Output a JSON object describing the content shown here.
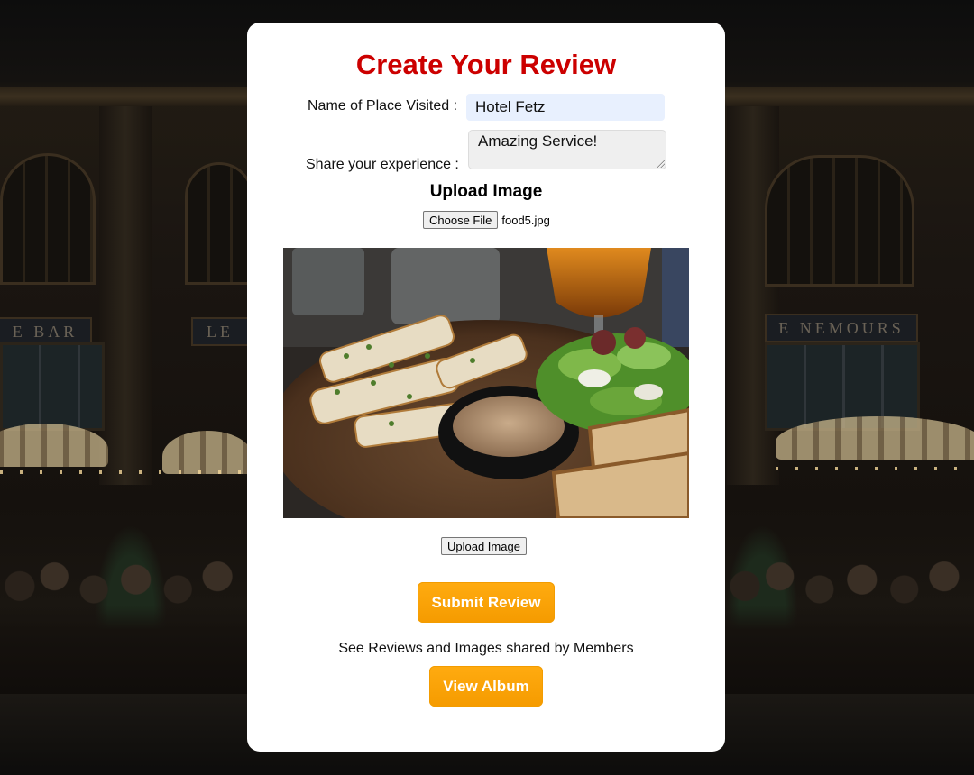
{
  "form": {
    "title": "Create Your Review",
    "name_label": "Name of Place Visited :",
    "name_value": "Hotel Fetz",
    "experience_label": "Share your experience :",
    "experience_value": "Amazing Service!",
    "upload_heading": "Upload Image",
    "choose_file_label": "Choose File",
    "file_name": "food5.jpg",
    "upload_button_label": "Upload Image",
    "submit_label": "Submit Review",
    "see_reviews_text": "See Reviews and Images shared by Members",
    "album_label": "View Album"
  },
  "background": {
    "sign_left": "E BAR",
    "sign_left_2": "LE",
    "sign_right": "E NEMOURS"
  },
  "colors": {
    "title": "#cc0000",
    "name_input_bg": "#e8f0fe",
    "button_orange": "#ffa500",
    "card_bg": "#ffffff"
  }
}
